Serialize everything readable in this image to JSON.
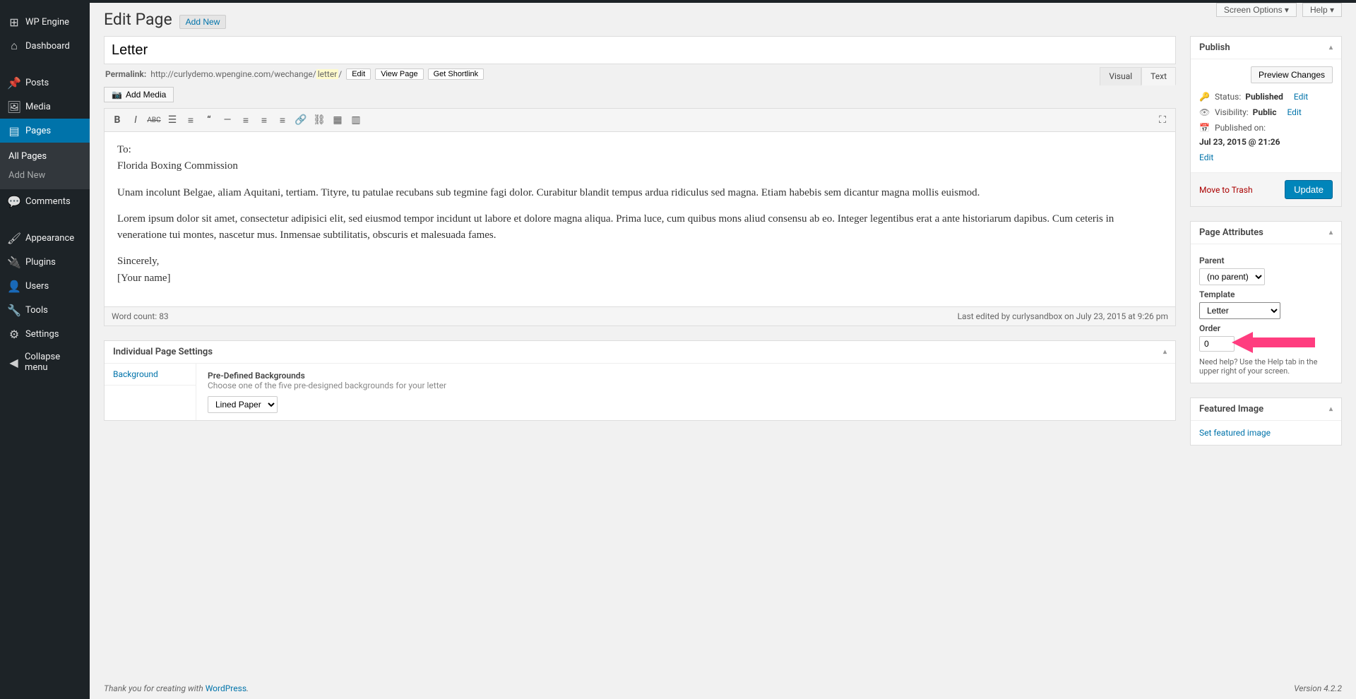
{
  "topbar": {
    "screen_options": "Screen Options",
    "help": "Help"
  },
  "sidebar": {
    "items": [
      {
        "icon": "wpe",
        "label": "WP Engine"
      },
      {
        "icon": "dash",
        "label": "Dashboard"
      },
      {
        "icon": "pin",
        "label": "Posts"
      },
      {
        "icon": "media",
        "label": "Media"
      },
      {
        "icon": "pages",
        "label": "Pages",
        "active": true
      },
      {
        "icon": "comments",
        "label": "Comments"
      },
      {
        "icon": "appearance",
        "label": "Appearance"
      },
      {
        "icon": "plugins",
        "label": "Plugins"
      },
      {
        "icon": "users",
        "label": "Users"
      },
      {
        "icon": "tools",
        "label": "Tools"
      },
      {
        "icon": "settings",
        "label": "Settings"
      },
      {
        "icon": "collapse",
        "label": "Collapse menu"
      }
    ],
    "pages_submenu": [
      "All Pages",
      "Add New"
    ]
  },
  "header": {
    "title": "Edit Page",
    "add_new": "Add New"
  },
  "title_field": "Letter",
  "permalink": {
    "label": "Permalink:",
    "base": "http://curlydemo.wpengine.com/wechange/",
    "slug": "letter",
    "suffix": "/",
    "edit": "Edit",
    "view": "View Page",
    "shortlink": "Get Shortlink"
  },
  "editor": {
    "add_media": "Add Media",
    "tabs": {
      "visual": "Visual",
      "text": "Text"
    },
    "content": {
      "p1a": "To:",
      "p1b": "Florida Boxing Commission",
      "p2": "Unam incolunt Belgae, aliam Aquitani, tertiam. Tityre, tu patulae recubans sub tegmine fagi dolor. Curabitur blandit tempus ardua ridiculus sed magna. Etiam habebis sem dicantur magna mollis euismod.",
      "p3": "Lorem ipsum dolor sit amet, consectetur adipisici elit, sed eiusmod tempor incidunt ut labore et dolore magna aliqua. Prima luce, cum quibus mons aliud consensu ab eo. Integer legentibus erat a ante historiarum dapibus. Cum ceteris in veneratione tui montes, nascetur mus. Inmensae subtilitatis, obscuris et malesuada fames.",
      "p4a": "Sincerely,",
      "p4b": "[Your name]"
    },
    "footer": {
      "wordcount_label": "Word count: ",
      "wordcount": "83",
      "lastedit": "Last edited by curlysandbox on July 23, 2015 at 9:26 pm"
    }
  },
  "ips": {
    "title": "Individual Page Settings",
    "tab": "Background",
    "field_label": "Pre-Defined Backgrounds",
    "field_desc": "Choose one of the five pre-designed backgrounds for your letter",
    "select_value": "Lined Paper"
  },
  "publish": {
    "title": "Publish",
    "preview": "Preview Changes",
    "status_label": "Status: ",
    "status": "Published",
    "vis_label": "Visibility: ",
    "vis": "Public",
    "pub_label": "Published on: ",
    "pub_date": "Jul 23, 2015 @ 21:26",
    "edit": "Edit",
    "trash": "Move to Trash",
    "update": "Update"
  },
  "attributes": {
    "title": "Page Attributes",
    "parent_label": "Parent",
    "parent_value": "(no parent)",
    "template_label": "Template",
    "template_value": "Letter",
    "order_label": "Order",
    "order_value": "0",
    "help": "Need help? Use the Help tab in the upper right of your screen."
  },
  "featured": {
    "title": "Featured Image",
    "link": "Set featured image"
  },
  "footer": {
    "thanks_pre": "Thank you for creating with ",
    "wordpress": "WordPress",
    "version": "Version 4.2.2"
  }
}
